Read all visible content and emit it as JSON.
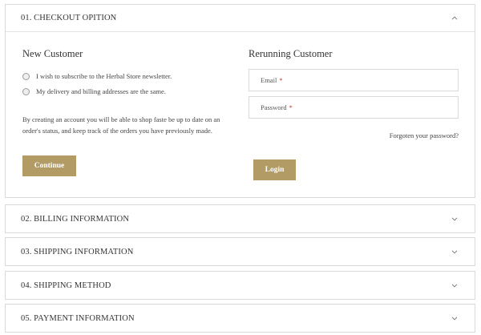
{
  "checkout": {
    "title": "01. CHECKOUT OPITION",
    "new_customer": {
      "heading": "New Customer",
      "options": [
        "I wish to subscribe to the Herbal Store newsletter.",
        "My delivery and billing addresses are the same."
      ],
      "note": "By creating an account you will be able to shop faste be up to date on an order's status, and keep track of the orders you have previously made.",
      "continue_label": "Continue"
    },
    "returning_customer": {
      "heading": "Rerunning Customer",
      "email_label": "Email",
      "password_label": "Password",
      "required_mark": "*",
      "forgot_label": "Forgoten your password?",
      "login_label": "Login"
    }
  },
  "steps": [
    {
      "title": "02. BILLING INFORMATION"
    },
    {
      "title": "03. SHIPPING INFORMATION"
    },
    {
      "title": "04. SHIPPING METHOD"
    },
    {
      "title": "05. PAYMENT INFORMATION"
    }
  ],
  "colors": {
    "button": "#b39b66",
    "border": "#d9d9d9",
    "required": "#c0392b"
  },
  "icons": {
    "open": "chevron-up-icon",
    "closed": "chevron-down-icon"
  }
}
